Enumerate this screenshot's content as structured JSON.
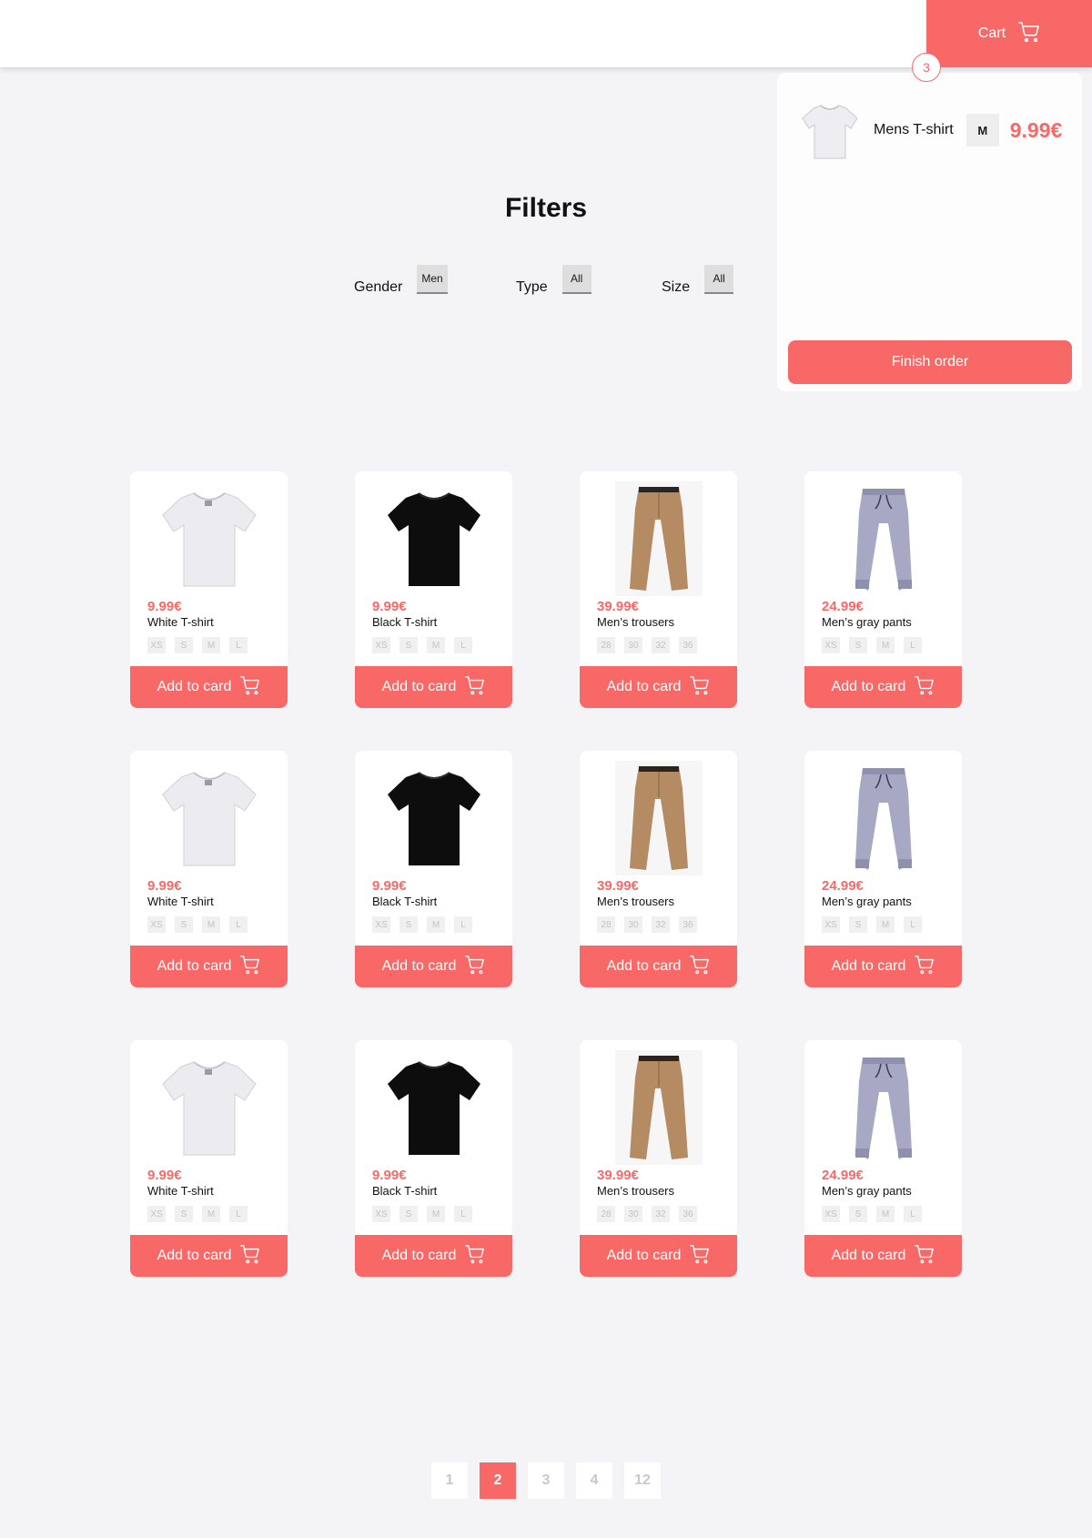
{
  "header": {
    "cart_label": "Cart",
    "cart_count": "3"
  },
  "cart_panel": {
    "items": [
      {
        "name": "Mens T-shirt",
        "size": "M",
        "price": "9.99€",
        "thumb": "white-tshirt"
      }
    ],
    "finish_label": "Finish order"
  },
  "filters": {
    "title": "Filters",
    "gender": {
      "label": "Gender",
      "value": "Men"
    },
    "type": {
      "label": "Type",
      "value": "All"
    },
    "size": {
      "label": "Size",
      "value": "All"
    }
  },
  "products": [
    {
      "price": "9.99€",
      "name": "White T-shirt",
      "sizes": [
        "XS",
        "S",
        "M",
        "L"
      ],
      "button": "Add to card",
      "image": "white-tshirt"
    },
    {
      "price": "9.99€",
      "name": "Black T-shirt",
      "sizes": [
        "XS",
        "S",
        "M",
        "L"
      ],
      "button": "Add to card",
      "image": "black-tshirt"
    },
    {
      "price": "39.99€",
      "name": "Men’s trousers",
      "sizes": [
        "28",
        "30",
        "32",
        "36"
      ],
      "button": "Add to card",
      "image": "khaki-trousers"
    },
    {
      "price": "24.99€",
      "name": "Men’s gray pants",
      "sizes": [
        "XS",
        "S",
        "M",
        "L"
      ],
      "button": "Add to card",
      "image": "gray-pants"
    },
    {
      "price": "9.99€",
      "name": "White T-shirt",
      "sizes": [
        "XS",
        "S",
        "M",
        "L"
      ],
      "button": "Add to card",
      "image": "white-tshirt"
    },
    {
      "price": "9.99€",
      "name": "Black T-shirt",
      "sizes": [
        "XS",
        "S",
        "M",
        "L"
      ],
      "button": "Add to card",
      "image": "black-tshirt"
    },
    {
      "price": "39.99€",
      "name": "Men’s trousers",
      "sizes": [
        "28",
        "30",
        "32",
        "36"
      ],
      "button": "Add to card",
      "image": "khaki-trousers"
    },
    {
      "price": "24.99€",
      "name": "Men’s gray pants",
      "sizes": [
        "XS",
        "S",
        "M",
        "L"
      ],
      "button": "Add to card",
      "image": "gray-pants"
    },
    {
      "price": "9.99€",
      "name": "White T-shirt",
      "sizes": [
        "XS",
        "S",
        "M",
        "L"
      ],
      "button": "Add to card",
      "image": "white-tshirt"
    },
    {
      "price": "9.99€",
      "name": "Black T-shirt",
      "sizes": [
        "XS",
        "S",
        "M",
        "L"
      ],
      "button": "Add to card",
      "image": "black-tshirt"
    },
    {
      "price": "39.99€",
      "name": "Men’s trousers",
      "sizes": [
        "28",
        "30",
        "32",
        "36"
      ],
      "button": "Add to card",
      "image": "khaki-trousers"
    },
    {
      "price": "24.99€",
      "name": "Men’s gray pants",
      "sizes": [
        "XS",
        "S",
        "M",
        "L"
      ],
      "button": "Add to card",
      "image": "gray-pants"
    }
  ],
  "pagination": {
    "pages": [
      "1",
      "2",
      "3",
      "4",
      "12"
    ],
    "current": "2"
  },
  "colors": {
    "accent": "#f86866",
    "background": "#f4f3f6",
    "card": "#ffffff"
  }
}
